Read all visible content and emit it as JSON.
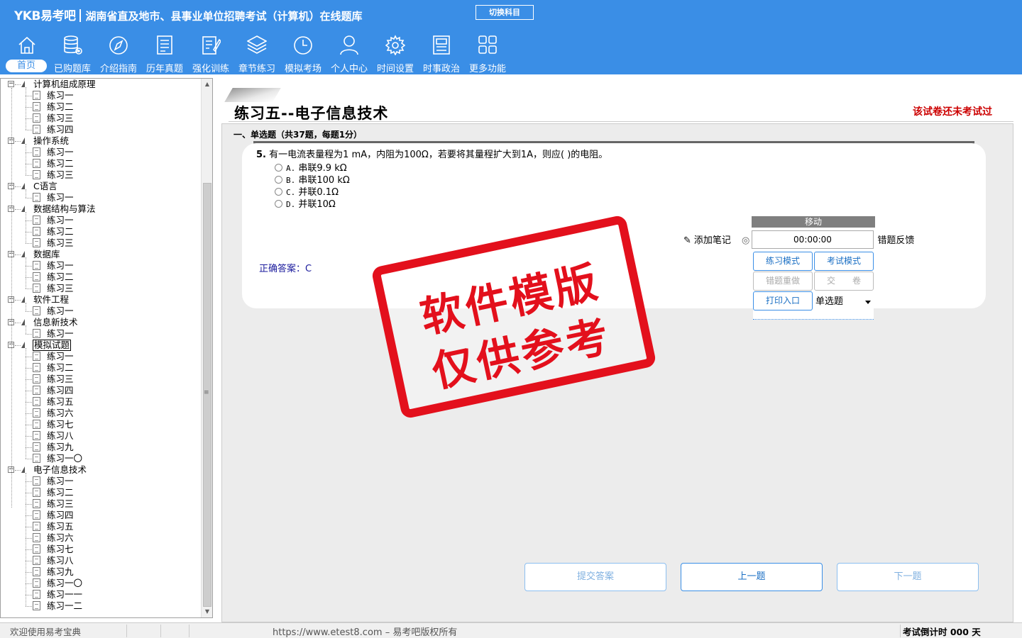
{
  "header": {
    "logo": "YKB易考吧",
    "title": "湖南省直及地市、县事业单位招聘考试（计算机）在线题库",
    "switch_label": "切换科目"
  },
  "nav": [
    {
      "label": "首页",
      "icon": "home-icon",
      "active": true
    },
    {
      "label": "已购题库",
      "icon": "database-icon"
    },
    {
      "label": "介绍指南",
      "icon": "compass-icon"
    },
    {
      "label": "历年真题",
      "icon": "list-document-icon"
    },
    {
      "label": "强化训练",
      "icon": "edit-document-icon"
    },
    {
      "label": "章节练习",
      "icon": "layers-icon"
    },
    {
      "label": "模拟考场",
      "icon": "clock-icon"
    },
    {
      "label": "个人中心",
      "icon": "user-icon"
    },
    {
      "label": "时间设置",
      "icon": "gear-icon"
    },
    {
      "label": "时事政治",
      "icon": "news-icon"
    },
    {
      "label": "更多功能",
      "icon": "grid-icon"
    }
  ],
  "tree": [
    {
      "label": "计算机组成原理",
      "children": [
        "练习一",
        "练习二",
        "练习三",
        "练习四"
      ]
    },
    {
      "label": "操作系统",
      "children": [
        "练习一",
        "练习二",
        "练习三"
      ]
    },
    {
      "label": "C语言",
      "children": [
        "练习一"
      ]
    },
    {
      "label": "数据结构与算法",
      "children": [
        "练习一",
        "练习二",
        "练习三"
      ]
    },
    {
      "label": "数据库",
      "children": [
        "练习一",
        "练习二",
        "练习三"
      ]
    },
    {
      "label": "软件工程",
      "children": [
        "练习一"
      ]
    },
    {
      "label": "信息新技术",
      "children": [
        "练习一"
      ]
    },
    {
      "label": "模拟试题",
      "selected": true,
      "children": [
        "练习一",
        "练习二",
        "练习三",
        "练习四",
        "练习五",
        "练习六",
        "练习七",
        "练习八",
        "练习九",
        "练习一〇"
      ]
    },
    {
      "label": "电子信息技术",
      "children": [
        "练习一",
        "练习二",
        "练习三",
        "练习四",
        "练习五",
        "练习六",
        "练习七",
        "练习八",
        "练习九",
        "练习一〇",
        "练习一一",
        "练习一二"
      ]
    }
  ],
  "main": {
    "title": "练习五--电子信息技术",
    "exam_status": "该试卷还未考试过",
    "section_title": "一、单选题（共37题，每题1分）",
    "question": {
      "number": "5.",
      "text": "有一电流表量程为1 mA，内阻为100Ω，若要将其量程扩大到1A，则应( )的电阻。",
      "options": [
        {
          "letter": "A.",
          "text": "串联9.9 kΩ"
        },
        {
          "letter": "B.",
          "text": "串联100 kΩ"
        },
        {
          "letter": "C.",
          "text": "并联0.1Ω"
        },
        {
          "letter": "D.",
          "text": "并联10Ω"
        }
      ],
      "answer": "正确答案：C"
    },
    "add_note": "添加笔记",
    "feedback": "错题反馈",
    "control": {
      "move_label": "移动",
      "timer": "00:00:00",
      "practice_mode": "练习模式",
      "exam_mode": "考试模式",
      "redo_wrong": "错题重做",
      "submit_paper": "交　　卷",
      "print_entry": "打印入口",
      "qtype_value": "单选题"
    },
    "stamp": {
      "line1": "软件模版",
      "line2": "仅供参考"
    },
    "buttons": {
      "submit": "提交答案",
      "prev": "上一题",
      "next": "下一题"
    }
  },
  "status": {
    "left": "欢迎使用易考宝典",
    "center": "https://www.etest8.com – 易考吧版权所有",
    "right": "考试倒计时 000 天"
  }
}
